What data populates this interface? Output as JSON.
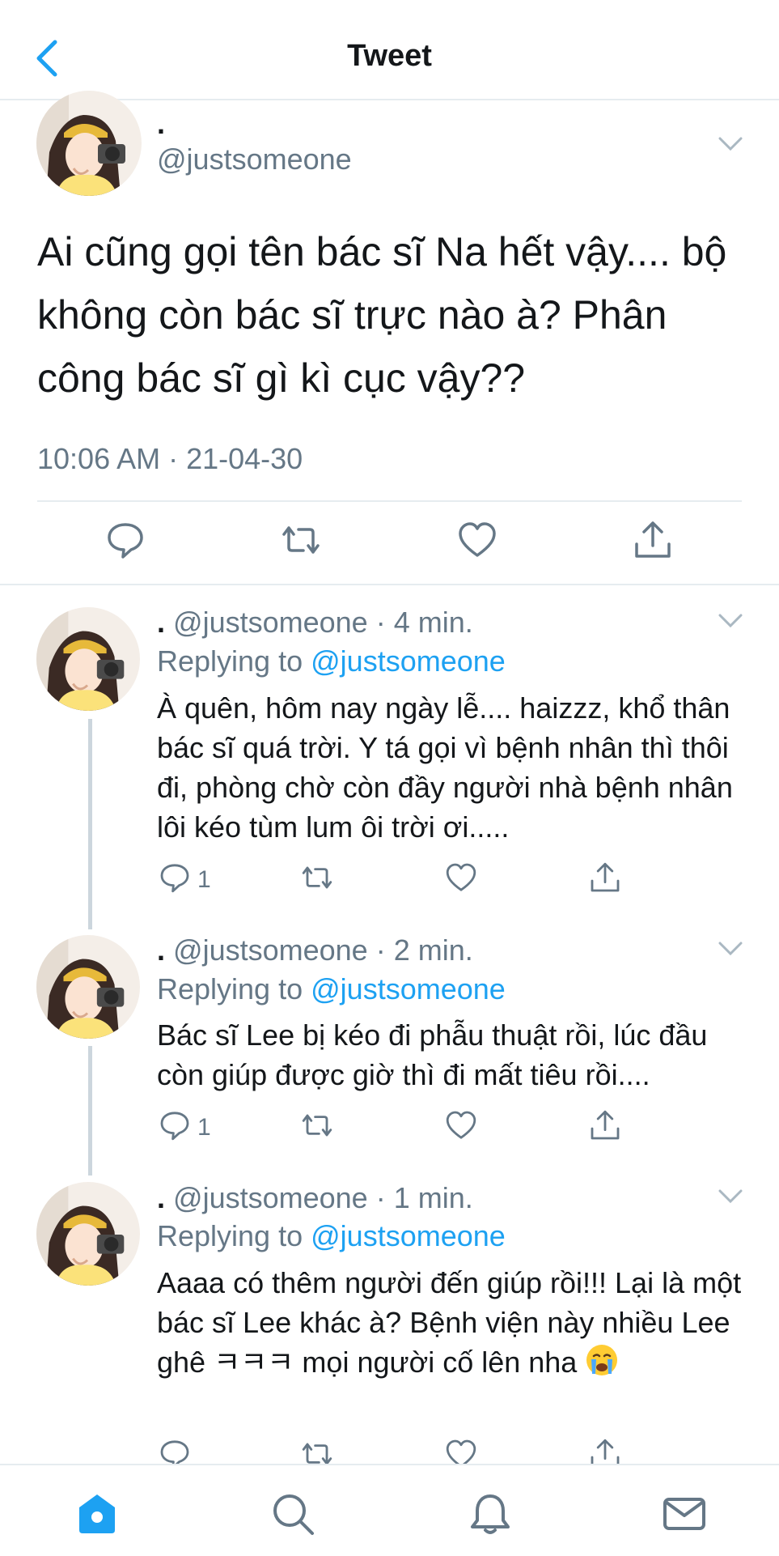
{
  "header": {
    "title": "Tweet"
  },
  "main_tweet": {
    "name": ".",
    "handle": "@justsomeone",
    "text": "Ai cũng gọi tên bác sĩ Na hết vậy.... bộ không còn bác sĩ trực nào à? Phân công bác sĩ gì kì cục vậy??",
    "timestamp": "10:06 AM · 21-04-30"
  },
  "replies": [
    {
      "name": ".",
      "handle": "@justsomeone",
      "time": "4 min.",
      "replying_label": "Replying to",
      "replying_to": "@justsomeone",
      "text": "À quên, hôm nay ngày lễ.... haizzz, khổ thân bác sĩ quá trời. Y tá gọi vì bệnh nhân thì thôi đi, phòng chờ còn đầy người nhà bệnh nhân lôi kéo tùm lum ôi trời ơi.....",
      "reply_count": "1"
    },
    {
      "name": ".",
      "handle": "@justsomeone",
      "time": "2 min.",
      "replying_label": "Replying to",
      "replying_to": "@justsomeone",
      "text": "Bác sĩ Lee bị kéo đi phẫu thuật rồi, lúc đầu còn giúp được giờ thì đi mất tiêu rồi....",
      "reply_count": "1"
    },
    {
      "name": ".",
      "handle": "@justsomeone",
      "time": "1 min.",
      "replying_label": "Replying to",
      "replying_to": "@justsomeone",
      "text": "Aaaa có thêm người đến giúp rồi!!! Lại là một bác sĩ Lee khác à? Bệnh viện này nhiều Lee ghê ㅋㅋㅋ mọi người cố lên nha",
      "emoji": "crying-face",
      "reply_count": ""
    }
  ],
  "tabs": [
    "home-icon",
    "search-icon",
    "notifications-icon",
    "messages-icon"
  ],
  "colors": {
    "accent": "#1da1f2",
    "secondary_text": "#657786",
    "divider": "#e6ecf0",
    "thread_line": "#ccd6dd"
  }
}
